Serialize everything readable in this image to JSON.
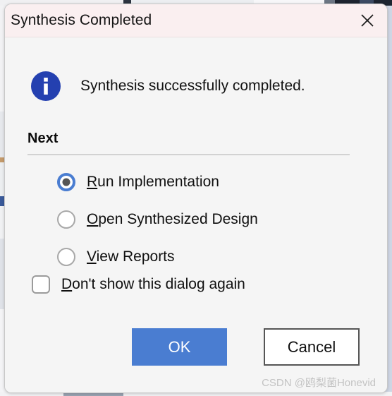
{
  "window": {
    "title": "Synthesis Completed",
    "close_icon": "close-x-icon"
  },
  "message": {
    "icon": "info-circle-icon",
    "text": "Synthesis successfully completed."
  },
  "next_section": {
    "heading": "Next",
    "options": [
      {
        "label": "Run Implementation",
        "mnemonic": "R",
        "rest": "un Implementation",
        "selected": true
      },
      {
        "label": "Open Synthesized Design",
        "mnemonic": "O",
        "rest": "pen Synthesized Design",
        "selected": false
      },
      {
        "label": "View Reports",
        "mnemonic": "V",
        "rest": "iew Reports",
        "selected": false
      }
    ]
  },
  "checkbox": {
    "label": "Don't show this dialog again",
    "mnemonic": "D",
    "rest": "on't show this dialog again",
    "checked": false
  },
  "buttons": {
    "ok_label": "OK",
    "cancel_label": "Cancel"
  },
  "watermark": {
    "text": "CSDN @鸥梨菌Honevid"
  },
  "colors": {
    "titlebar_background": "#faeff0",
    "dialog_background": "#f5f5f5",
    "accent_blue": "#4a7dd1",
    "info_icon_blue": "#2440b0",
    "radio_unselected_border": "#a8a8a8",
    "radio_dot": "#555555",
    "separator": "#d2d2d2",
    "cancel_border": "#555555",
    "watermark": "#c3c3c3"
  }
}
